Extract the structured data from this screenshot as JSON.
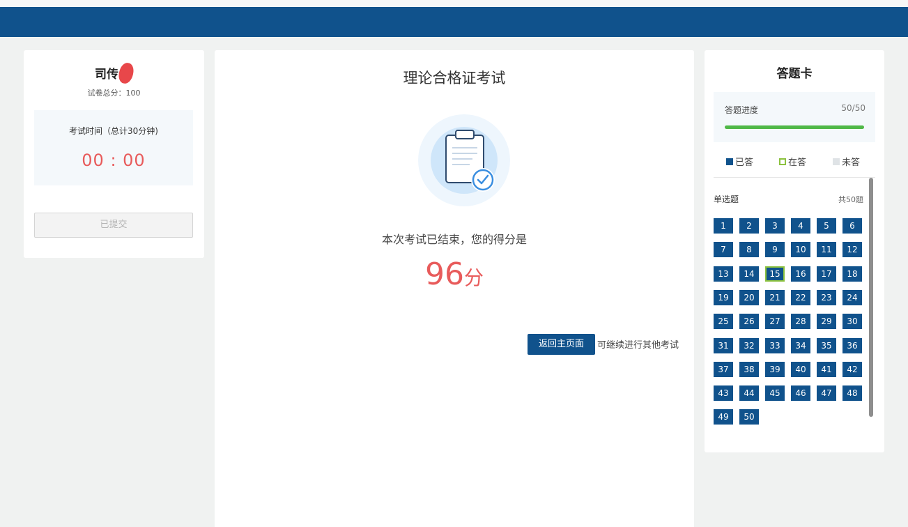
{
  "candidate": {
    "name": "司传"
  },
  "exam": {
    "total_score_label": "试卷总分：100",
    "time_label": "考试时间（总计30分钟)",
    "timer": "00 : 00",
    "submitted_label": "已提交",
    "title": "理论合格证考试",
    "end_message": "本次考试已结束，您的得分是",
    "score": "96",
    "score_unit": "分",
    "home_button": "返回主页面",
    "continue_text": "可继续进行其他考试"
  },
  "answer_card": {
    "title": "答题卡",
    "progress_label": "答题进度",
    "progress_count": "50/50",
    "progress_fraction": 1.0,
    "legend": {
      "answered": "已答",
      "current": "在答",
      "unanswered": "未答"
    },
    "section_name": "单选题",
    "section_count": "共50题",
    "current_question": 15
  },
  "colors": {
    "header": "#10528c",
    "accent_red": "#e85b5b",
    "progress_green": "#4fb847",
    "current_outline": "#8cc23f"
  },
  "icons": [
    "clipboard-check-icon"
  ]
}
